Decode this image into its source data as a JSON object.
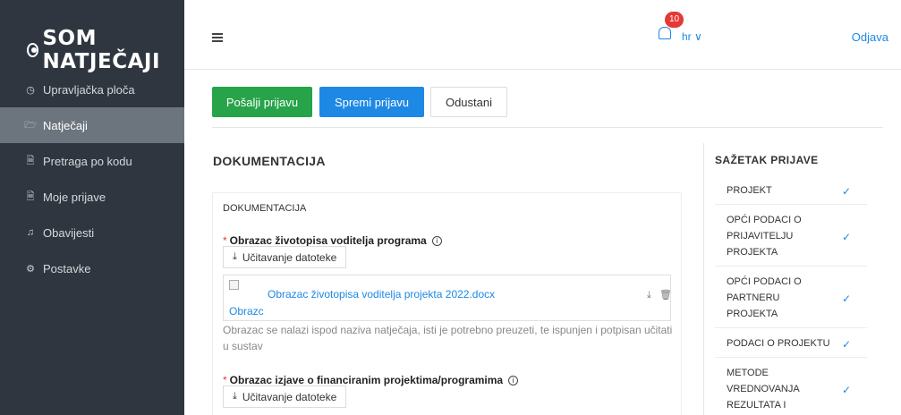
{
  "brand": {
    "name": "SOM NATJEČAJI"
  },
  "sidebar": {
    "items": [
      {
        "label": "Upravljačka ploča",
        "icon": "dashboard-icon"
      },
      {
        "label": "Natječaji",
        "icon": "folder-icon",
        "active": true
      },
      {
        "label": "Pretraga po kodu",
        "icon": "document-icon"
      },
      {
        "label": "Moje prijave",
        "icon": "document-icon"
      },
      {
        "label": "Obavijesti",
        "icon": "bell-icon"
      },
      {
        "label": "Postavke",
        "icon": "gear-icon"
      }
    ]
  },
  "header": {
    "notification_count": "10",
    "language": "hr ∨",
    "logout": "Odjava"
  },
  "actions": {
    "send": "Pošalji prijavu",
    "save": "Spremi prijavu",
    "cancel": "Odustani"
  },
  "main": {
    "section_title": "DOKUMENTACIJA",
    "card_title": "DOKUMENTACIJA",
    "field1": {
      "label": "Obrazac životopisa voditelja programa",
      "upload_label": "Učitavanje datoteke",
      "file_name": "Obrazac životopisa voditelja projekta 2022.docx",
      "thumb_alt": "Obrazc",
      "hint": "Obrazac se nalazi ispod naziva natječaja, isti je potrebno preuzeti, te ispunjen i potpisan učitati u sustav"
    },
    "field2": {
      "label": "Obrazac izjave o financiranim projektima/programima",
      "upload_label": "Učitavanje datoteke"
    }
  },
  "summary": {
    "title": "SAŽETAK PRIJAVE",
    "items": [
      {
        "label": "PROJEKT",
        "check": "✓"
      },
      {
        "label": "OPĆI PODACI O PRIJAVITELJU PROJEKTA",
        "check": "✓"
      },
      {
        "label": "OPĆI PODACI O PARTNERU PROJEKTA",
        "check": "✓"
      },
      {
        "label": "PODACI O PROJEKTU",
        "check": "✓"
      },
      {
        "label": "METODE VREDNOVANJA REZULTATA I",
        "check": "✓"
      }
    ]
  },
  "colors": {
    "sidebar": "#2f3640",
    "active_item": "#6c757d",
    "primary": "#1e88e5",
    "success": "#27a34a",
    "danger": "#e53935"
  }
}
